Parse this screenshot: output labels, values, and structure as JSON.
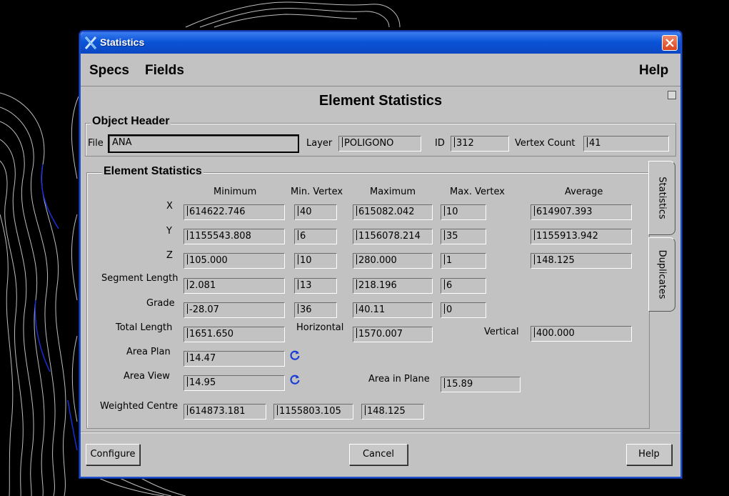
{
  "window": {
    "title": "Statistics"
  },
  "menu": {
    "specs": "Specs",
    "fields": "Fields",
    "help": "Help"
  },
  "heading": "Element Statistics",
  "object_header": {
    "legend": "Object Header",
    "file_label": "File",
    "file_value": "ANA",
    "layer_label": "Layer",
    "layer_value": "POLIGONO",
    "id_label": "ID",
    "id_value": "312",
    "vertex_count_label": "Vertex Count",
    "vertex_count_value": "41"
  },
  "stats": {
    "legend": "Element Statistics",
    "columns": {
      "minimum": "Minimum",
      "min_vertex": "Min. Vertex",
      "maximum": "Maximum",
      "max_vertex": "Max. Vertex",
      "average": "Average"
    },
    "rows": [
      {
        "label": "X",
        "minimum": "614622.746",
        "min_vertex": "40",
        "maximum": "615082.042",
        "max_vertex": "10",
        "average": "614907.393"
      },
      {
        "label": "Y",
        "minimum": "1155543.808",
        "min_vertex": "6",
        "maximum": "1156078.214",
        "max_vertex": "35",
        "average": "1155913.942"
      },
      {
        "label": "Z",
        "minimum": "105.000",
        "min_vertex": "10",
        "maximum": "280.000",
        "max_vertex": "1",
        "average": "148.125"
      },
      {
        "label": "Segment Length",
        "minimum": "2.081",
        "min_vertex": "13",
        "maximum": "218.196",
        "max_vertex": "6"
      },
      {
        "label": "Grade",
        "minimum": "-28.07",
        "min_vertex": "36",
        "maximum": "40.11",
        "max_vertex": "0"
      }
    ],
    "total_length_label": "Total Length",
    "total_length": "1651.650",
    "horizontal_label": "Horizontal",
    "horizontal": "1570.007",
    "vertical_label": "Vertical",
    "vertical": "400.000",
    "area_plan_label": "Area Plan",
    "area_plan": "14.47",
    "area_view_label": "Area View",
    "area_view": "14.95",
    "area_in_plane_label": "Area in Plane",
    "area_in_plane": "15.89",
    "weighted_centre_label": "Weighted Centre",
    "weighted_centre": [
      "614873.181",
      "1155803.105",
      "148.125"
    ]
  },
  "tabs": {
    "statistics": "Statistics",
    "duplicates": "Duplicates"
  },
  "buttons": {
    "configure": "Configure",
    "cancel": "Cancel",
    "help": "Help"
  },
  "colors": {
    "title_bar": "#0a54d8",
    "close_button": "#d9431c",
    "refresh_icon": "#1a3fd6",
    "dialog_bg": "#c2c2c2"
  }
}
